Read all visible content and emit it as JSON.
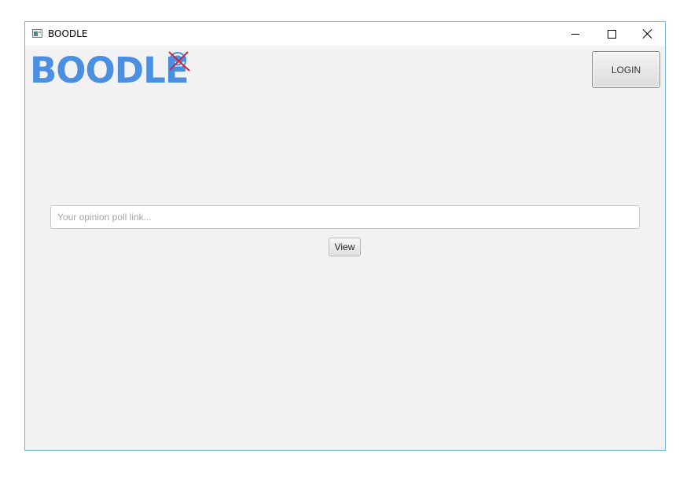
{
  "window": {
    "title": "BOODLE"
  },
  "header": {
    "logo_text": "BOODLE",
    "login_label": "LOGIN"
  },
  "main": {
    "poll_input": {
      "placeholder": "Your opinion poll link...",
      "value": ""
    },
    "view_label": "View"
  },
  "colors": {
    "logo": "#4a8fe0",
    "accent_border": "#3e9bd5",
    "logo_mark_cross": "#d0243a",
    "background": "#f2f2f2"
  }
}
